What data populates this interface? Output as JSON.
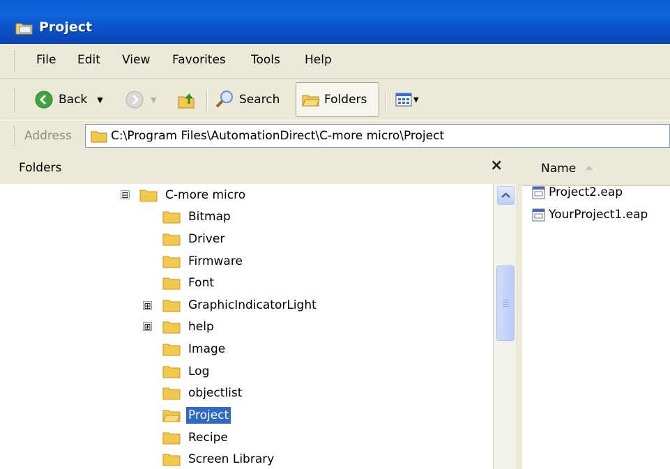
{
  "window": {
    "title": "Project",
    "icon": "folder-window-icon"
  },
  "menu": {
    "items": [
      "File",
      "Edit",
      "View",
      "Favorites",
      "Tools",
      "Help"
    ]
  },
  "toolbar": {
    "back_label": "Back",
    "search_label": "Search",
    "folders_label": "Folders"
  },
  "address": {
    "label": "Address",
    "path": "C:\\Program Files\\AutomationDirect\\C-more micro\\Project"
  },
  "folders_pane": {
    "title": "Folders",
    "close_glyph": "×",
    "tree": [
      {
        "label": "C-more micro",
        "expander": "⊟"
      },
      {
        "label": "Bitmap"
      },
      {
        "label": "Driver"
      },
      {
        "label": "Firmware"
      },
      {
        "label": "Font"
      },
      {
        "label": "GraphicIndicatorLight",
        "expander": "⊞"
      },
      {
        "label": "help",
        "expander": "⊞"
      },
      {
        "label": "Image"
      },
      {
        "label": "Log"
      },
      {
        "label": "objectlist"
      },
      {
        "label": "Project",
        "selected": true
      },
      {
        "label": "Recipe"
      },
      {
        "label": "Screen Library"
      }
    ]
  },
  "file_list": {
    "column_name": "Name",
    "files": [
      "Project2.eap",
      "YourProject1.eap"
    ]
  },
  "colors": {
    "titlebar": "#0a5fd8",
    "chrome": "#ece9d8",
    "selection": "#316ac5",
    "folder": "#f2c94c"
  }
}
